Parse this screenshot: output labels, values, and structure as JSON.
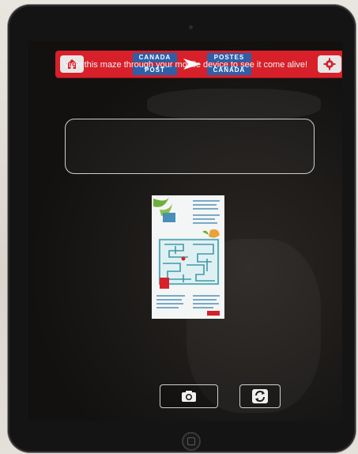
{
  "header": {
    "logo": {
      "left_top": "CANADA",
      "left_bottom": "POST",
      "right_top": "POSTES",
      "right_bottom": "CANADA"
    },
    "home_icon": "home-icon",
    "settings_icon": "gear-icon"
  },
  "message": "View this maze through your mobile device to see it come alive!",
  "buttons": {
    "camera_icon": "camera-icon",
    "refresh_icon": "refresh-icon"
  },
  "colors": {
    "brand_red": "#d8202a",
    "brand_blue": "#2e5fa8"
  }
}
